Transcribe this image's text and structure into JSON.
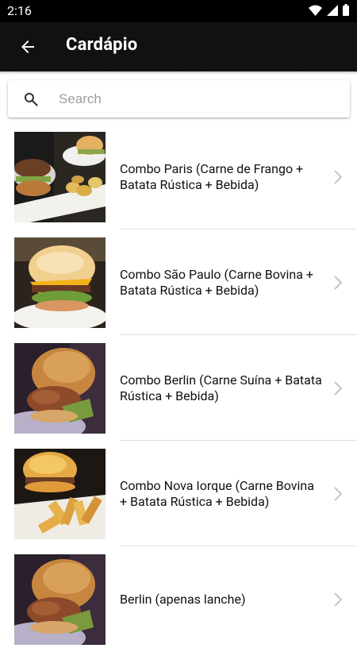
{
  "status_bar": {
    "time": "2:16"
  },
  "header": {
    "title": "Cardápio"
  },
  "search": {
    "placeholder": "Search",
    "value": ""
  },
  "menu_items": [
    {
      "label": "Combo Paris (Carne de Frango + Batata Rústica + Bebida)"
    },
    {
      "label": "Combo São Paulo (Carne Bovina + Batata Rústica + Bebida)"
    },
    {
      "label": "Combo Berlin (Carne Suína + Batata Rústica + Bebida)"
    },
    {
      "label": "Combo Nova Iorque (Carne Bovina + Batata Rústica + Bebida)"
    },
    {
      "label": "Berlin (apenas lanche)"
    }
  ],
  "colors": {
    "app_bar": "#111111",
    "status_bar": "#000000",
    "divider": "#e0e0e0",
    "chevron": "#c4c4c4"
  }
}
